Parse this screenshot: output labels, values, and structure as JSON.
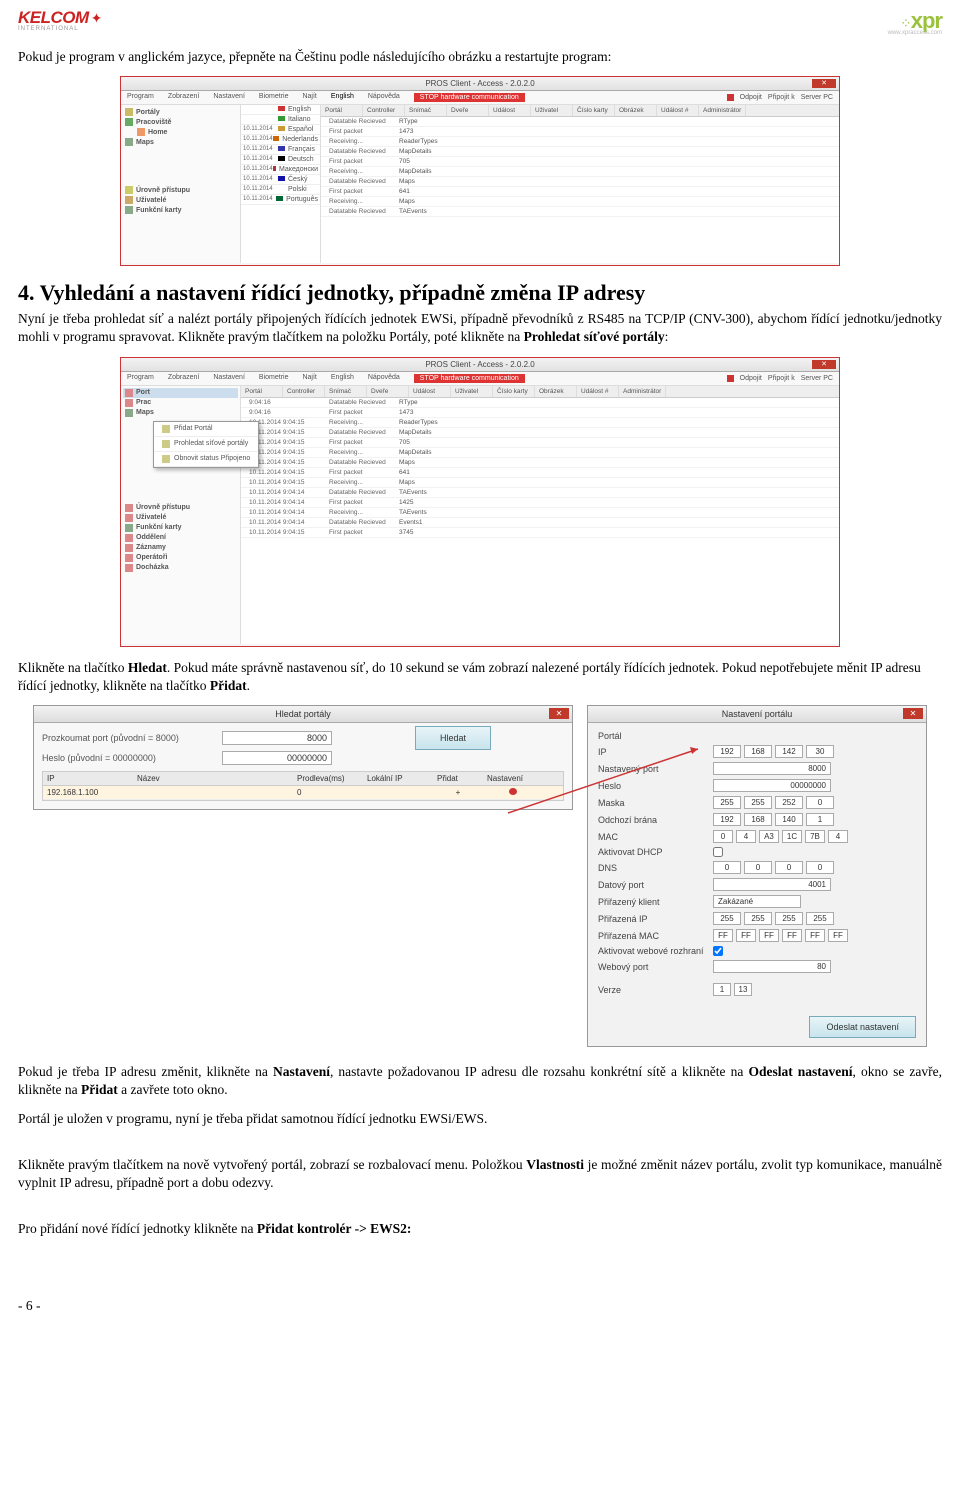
{
  "logos": {
    "left_name": "KELCOM",
    "left_sub": "INTERNATIONAL",
    "right_name": "xpr",
    "right_sub": "www.xpraccess.com"
  },
  "intro": "Pokud je program v anglickém jazyce, přepněte na Češtinu podle následujícího obrázku a restartujte program:",
  "section4_title": "4. Vyhledání a nastavení řídící jednotky, případně změna IP adresy",
  "section4_para": "Nyní je třeba prohledat síť a nalézt portály připojených řídících jednotek EWSi, případně převodníků z RS485 na TCP/IP (CNV-300), abychom řídící jednotku/jednotky mohli v programu spravovat. Klikněte pravým tlačítkem na položku Portály, poté klikněte na ",
  "section4_bold": "Prohledat síťové portály",
  "para2a": "Klikněte na tlačítko ",
  "para2_hledat": "Hledat",
  "para2b": ". Pokud máte správně nastavenou síť, do 10 sekund se vám zobrazí nalezené portály řídících jednotek. Pokud nepotřebujete měnit IP adresu řídící jednotky, klikněte na tlačítko ",
  "para2_pridat": "Přidat",
  "para3a": "Pokud je třeba IP adresu změnit, klikněte na ",
  "para3_nastaveni": "Nastavení",
  "para3b": ", nastavte požadovanou IP adresu dle rozsahu konkrétní sítě a klikněte na ",
  "para3_odeslat": "Odeslat nastavení",
  "para3c": ", okno se zavře, klikněte na ",
  "para3_pridat": "Přidat",
  "para3d": " a zavřete toto okno.",
  "para4": "Portál je uložen v programu, nyní je třeba přidat samotnou řídící jednotku EWSi/EWS.",
  "para5a": "Klikněte pravým tlačítkem na nově vytvořený portál, zobrazí se rozbalovací menu. Položkou ",
  "para5_vlastnosti": "Vlastnosti",
  "para5b": " je možné změnit název portálu, zvolit typ komunikace, manuálně vyplnit IP adresu, případně port a dobu odezvy.",
  "para6a": "Pro přidání nové řídící jednotky klikněte na ",
  "para6_bold": "Přidat kontrolér -> EWS2:",
  "ss": {
    "title": "PROS Client - Access - 2.0.2.0",
    "menus": [
      "Program",
      "Zobrazení",
      "Nastavení",
      "Biometrie",
      "Najít",
      "English",
      "Nápověda"
    ],
    "menus2": [
      "Program",
      "Zobrazení",
      "Nastavení",
      "Biometrie",
      "Najít",
      "English",
      "Nápověda"
    ],
    "stop": "STOP hardware communication",
    "right_items": [
      "Odpojit",
      "Připojit k",
      "Server PC"
    ],
    "tree1": [
      "Portály",
      "Pracoviště",
      "Home",
      "Maps"
    ],
    "tree1_bottom": [
      "Úrovně přístupu",
      "Uživatelé",
      "Funkční karty"
    ],
    "tree2_bottom": [
      "Úrovně přístupu",
      "Uživatelé",
      "Funkční karty",
      "Oddělení",
      "Záznamy",
      "Operátoři",
      "Docházka"
    ],
    "langs": [
      {
        "flag": "#c33",
        "name": "English"
      },
      {
        "flag": "#393",
        "name": "Italiano"
      },
      {
        "flag": "#c93",
        "name": "Español"
      },
      {
        "flag": "#c60",
        "name": "Nederlands"
      },
      {
        "flag": "#33a",
        "name": "Français"
      },
      {
        "flag": "#000",
        "name": "Deutsch"
      },
      {
        "flag": "#a33",
        "name": "Македонски"
      },
      {
        "flag": "#11a",
        "name": "Český"
      },
      {
        "flag": "#fff",
        "name": "Polski"
      },
      {
        "flag": "#063",
        "name": "Português"
      }
    ],
    "lang_date": "10.11.2014",
    "lang_long_date": "10.11.2014 9:04:15",
    "table_hdr": [
      "Portál",
      "Controller",
      "Snímač",
      "Dveře",
      "Událost",
      "Uživatel",
      "Číslo karty",
      "Obrázek",
      "Událost #",
      "Administrátor"
    ],
    "tbl_rows": [
      [
        "Datatable Recieved",
        "RType"
      ],
      [
        "First packet",
        "1473"
      ],
      [
        "Receiving...",
        "ReaderTypes"
      ],
      [
        "Datatable Recieved",
        "MapDetails"
      ],
      [
        "First packet",
        "705"
      ],
      [
        "Receiving...",
        "MapDetails"
      ],
      [
        "Datatable Recieved",
        "Maps"
      ],
      [
        "First packet",
        "641"
      ],
      [
        "Receiving...",
        "Maps"
      ],
      [
        "Datatable Recieved",
        "TAEvents"
      ]
    ],
    "tbl2_dates": [
      "9:04:16",
      "9:04:16",
      "10.11.2014 9:04:15",
      "10.11.2014 9:04:15",
      "10.11.2014 9:04:15",
      "10.11.2014 9:04:15",
      "10.11.2014 9:04:15",
      "10.11.2014 9:04:15",
      "10.11.2014 9:04:15",
      "10.11.2014 9:04:14",
      "10.11.2014 9:04:14",
      "10.11.2014 9:04:14",
      "10.11.2014 9:04:14"
    ],
    "tbl2_rows": [
      [
        "Datatable Recieved",
        "RType"
      ],
      [
        "First packet",
        "1473"
      ],
      [
        "Receiving...",
        "ReaderTypes"
      ],
      [
        "Datatable Recieved",
        "MapDetails"
      ],
      [
        "First packet",
        "705"
      ],
      [
        "Receiving...",
        "MapDetails"
      ],
      [
        "Datatable Recieved",
        "Maps"
      ],
      [
        "First packet",
        "641"
      ],
      [
        "Receiving...",
        "Maps"
      ],
      [
        "Datatable Recieved",
        "TAEvents"
      ],
      [
        "First packet",
        "1425"
      ],
      [
        "Receiving...",
        "TAEvents"
      ],
      [
        "Datatable Recieved",
        "Events1"
      ],
      [
        "First packet",
        "3745"
      ]
    ],
    "ctx": [
      "Přidat Portál",
      "Prohledat síťové portály",
      "Obnovit status Připojeno"
    ]
  },
  "dlg1": {
    "title": "Hledat portály",
    "row1_label": "Prozkoumat port (původní = 8000)",
    "row1_val": "8000",
    "row2_label": "Heslo (původní = 00000000)",
    "row2_val": "00000000",
    "btn": "Hledat",
    "hdr": [
      "IP",
      "Název",
      "Prodleva(ms)",
      "Lokální IP",
      "Přidat",
      "Nastavení"
    ],
    "row_ip": "192.168.1.100",
    "row_delay": "0",
    "row_add": "+"
  },
  "dlg2": {
    "title": "Nastavení portálu",
    "lbl_portal": "Portál",
    "lbl_ip": "IP",
    "ip": [
      "192",
      "168",
      "142",
      "30"
    ],
    "lbl_port": "Nastavený port",
    "port": "8000",
    "lbl_heslo": "Heslo",
    "heslo": "00000000",
    "lbl_maska": "Maska",
    "maska": [
      "255",
      "255",
      "252",
      "0"
    ],
    "lbl_brana": "Odchozí brána",
    "brana": [
      "192",
      "168",
      "140",
      "1"
    ],
    "lbl_mac": "MAC",
    "mac": [
      "0",
      "4",
      "A3",
      "1C",
      "7B",
      "4"
    ],
    "lbl_dhcp": "Aktivovat DHCP",
    "lbl_dns": "DNS",
    "dns": [
      "0",
      "0",
      "0",
      "0"
    ],
    "lbl_dport": "Datový port",
    "dport": "4001",
    "lbl_klient": "Přiřazený klient",
    "klient": "Zakázané",
    "lbl_pip": "Přiřazená IP",
    "pip": [
      "255",
      "255",
      "255",
      "255"
    ],
    "lbl_pmac": "Přiřazená MAC",
    "pmac": [
      "FF",
      "FF",
      "FF",
      "FF",
      "FF",
      "FF"
    ],
    "lbl_web": "Aktivovat webové rozhraní",
    "lbl_wport": "Webový port",
    "wport": "80",
    "lbl_verze": "Verze",
    "verze": [
      "1",
      "13"
    ],
    "btn": "Odeslat nastavení"
  },
  "footer": "- 6 -"
}
